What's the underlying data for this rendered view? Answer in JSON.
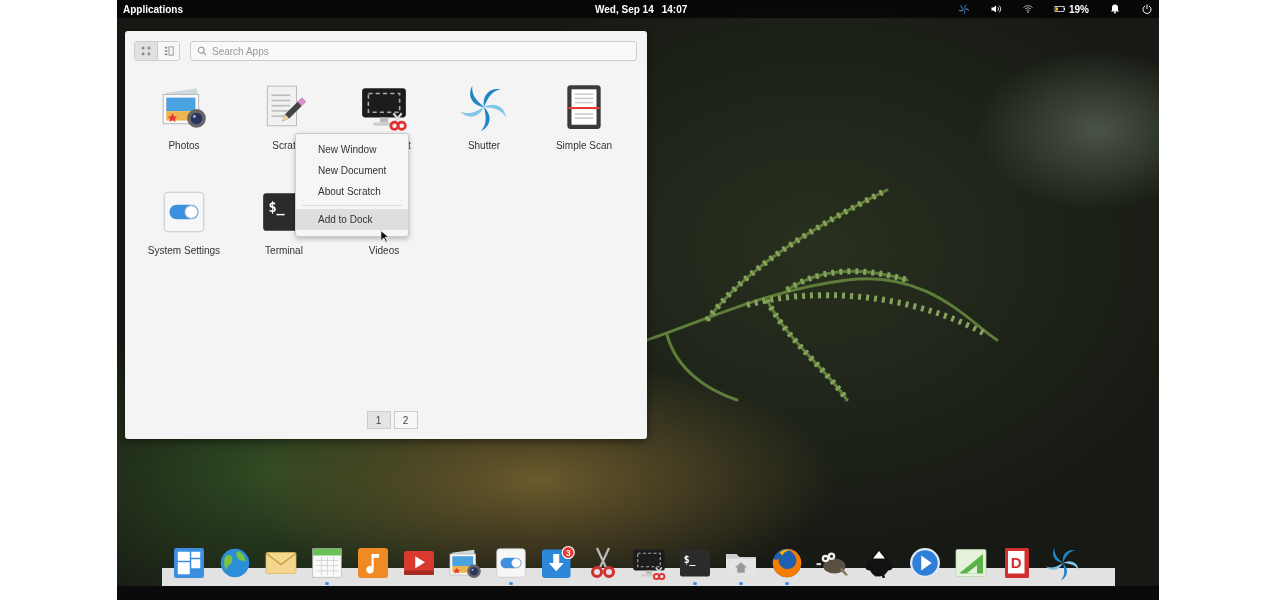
{
  "top_bar": {
    "menu": "Applications",
    "date": "Wed, Sep 14",
    "time": "14:07",
    "tray": [
      {
        "kind": "shutter"
      },
      {
        "kind": "volume"
      },
      {
        "kind": "wifi"
      },
      {
        "kind": "battery",
        "label": "19%"
      },
      {
        "kind": "bell"
      },
      {
        "kind": "power"
      }
    ]
  },
  "launcher": {
    "view_modes": [
      {
        "kind": "grid",
        "selected": true
      },
      {
        "kind": "list",
        "selected": false
      }
    ],
    "search": {
      "placeholder": "Search Apps"
    },
    "apps": [
      {
        "kind": "photos",
        "label": "Photos"
      },
      {
        "kind": "scratch",
        "label": "Scrat"
      },
      {
        "kind": "screenshot",
        "label": "t"
      },
      {
        "kind": "shutter",
        "label": "Shutter"
      },
      {
        "kind": "scan",
        "label": "Simple Scan"
      },
      {
        "kind": "settings",
        "label": "System Settings"
      },
      {
        "kind": "terminal",
        "label": "Terminal",
        "glyph": "$_"
      },
      {
        "kind": "videos",
        "label": "Videos"
      }
    ],
    "pages": [
      {
        "label": "1",
        "selected": true
      },
      {
        "label": "2",
        "selected": false
      }
    ]
  },
  "context_menu": {
    "items": [
      {
        "kind": "item",
        "label": "New Window",
        "highlighted": false
      },
      {
        "kind": "item",
        "label": "New Document",
        "highlighted": false
      },
      {
        "kind": "item",
        "label": "About Scratch",
        "highlighted": false
      },
      {
        "kind": "separator"
      },
      {
        "kind": "item",
        "label": "Add to Dock",
        "highlighted": true
      }
    ]
  },
  "dock": {
    "items": [
      {
        "kind": "tiles",
        "running": false
      },
      {
        "kind": "globe",
        "running": false
      },
      {
        "kind": "mail",
        "running": false
      },
      {
        "kind": "calendar",
        "running": true
      },
      {
        "kind": "music",
        "running": false
      },
      {
        "kind": "youtube",
        "running": false
      },
      {
        "kind": "photos",
        "running": false
      },
      {
        "kind": "settings",
        "running": true
      },
      {
        "kind": "download",
        "running": false,
        "badge": "3"
      },
      {
        "kind": "scissors",
        "running": false
      },
      {
        "kind": "screenshot",
        "running": false
      },
      {
        "kind": "terminal",
        "running": true,
        "glyph": "$_"
      },
      {
        "kind": "folder",
        "running": true
      },
      {
        "kind": "firefox",
        "running": true
      },
      {
        "kind": "gimp",
        "running": false
      },
      {
        "kind": "inkscape",
        "running": false
      },
      {
        "kind": "play",
        "running": false
      },
      {
        "kind": "chart",
        "running": false
      },
      {
        "kind": "document",
        "running": false,
        "glyph": "D"
      },
      {
        "kind": "shutter",
        "running": false
      }
    ]
  }
}
